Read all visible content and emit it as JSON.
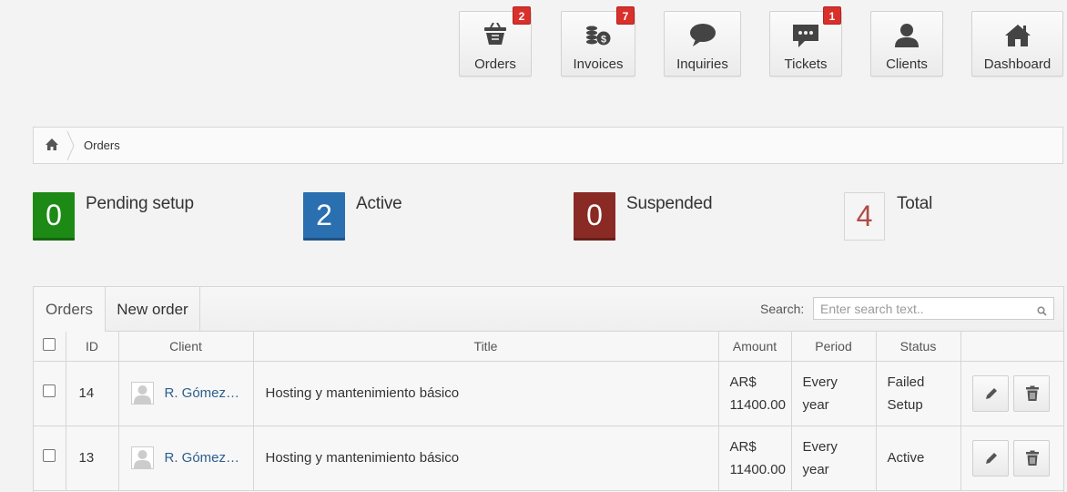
{
  "shortcuts": [
    {
      "label": "Orders",
      "badge": "2",
      "icon": "basket-icon"
    },
    {
      "label": "Invoices",
      "badge": "7",
      "icon": "coins-icon"
    },
    {
      "label": "Inquiries",
      "badge": null,
      "icon": "speech-bubble-icon"
    },
    {
      "label": "Tickets",
      "badge": "1",
      "icon": "ticket-chat-icon"
    },
    {
      "label": "Clients",
      "badge": null,
      "icon": "user-icon"
    },
    {
      "label": "Dashboard",
      "badge": null,
      "icon": "home-icon"
    }
  ],
  "breadcrumb": {
    "current": "Orders"
  },
  "stats": [
    {
      "value": "0",
      "caption": "Pending setup",
      "color": "#1d8a15"
    },
    {
      "value": "2",
      "caption": "Active",
      "color": "#2a6fb0"
    },
    {
      "value": "0",
      "caption": "Suspended",
      "color": "#8a2a24"
    },
    {
      "value": "4",
      "caption": "Total",
      "color": "#b04b45"
    }
  ],
  "tabs": {
    "orders": "Orders",
    "new_order": "New order"
  },
  "search": {
    "label": "Search:",
    "placeholder": "Enter search text.."
  },
  "table": {
    "headers": {
      "id": "ID",
      "client": "Client",
      "title": "Title",
      "amount": "Amount",
      "period": "Period",
      "status": "Status"
    },
    "rows": [
      {
        "id": "14",
        "client": "R. Gómez…",
        "title": "Hosting y mantenimiento básico",
        "currency": "AR$",
        "amount": "11400.00",
        "period_1": "Every",
        "period_2": "year",
        "status_1": "Failed",
        "status_2": "Setup"
      },
      {
        "id": "13",
        "client": "R. Gómez…",
        "title": "Hosting y mantenimiento básico",
        "currency": "AR$",
        "amount": "11400.00",
        "period_1": "Every",
        "period_2": "year",
        "status_1": "Active",
        "status_2": ""
      }
    ]
  }
}
